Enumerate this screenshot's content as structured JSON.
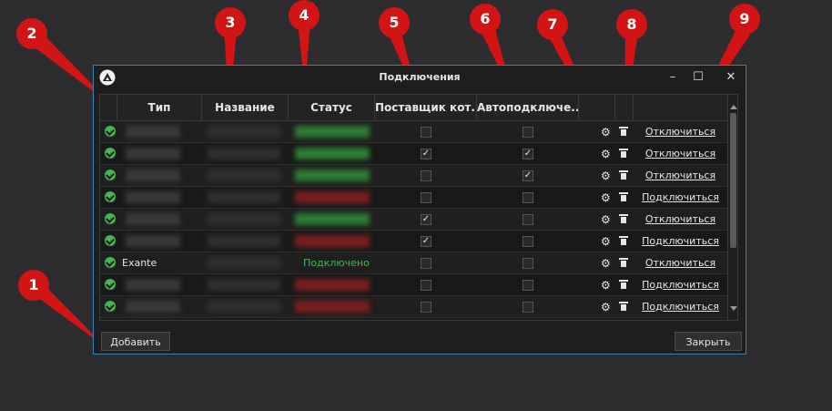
{
  "window": {
    "title": "Подключения",
    "controls": {
      "minimize": "–",
      "maximize": "☐",
      "close": "✕"
    }
  },
  "table": {
    "columns": [
      "Тип",
      "Название",
      "Статус",
      "Поставщик кот...",
      "Автоподключе..."
    ],
    "rows": [
      {
        "type": "",
        "status": "",
        "status_color": "#2e7d32",
        "quotes_provider": false,
        "auto_connect": false,
        "action": "Отключиться"
      },
      {
        "type": "",
        "status": "",
        "status_color": "#2e7d32",
        "quotes_provider": true,
        "auto_connect": true,
        "action": "Отключиться"
      },
      {
        "type": "",
        "status": "",
        "status_color": "#2e7d32",
        "quotes_provider": false,
        "auto_connect": true,
        "action": "Отключиться"
      },
      {
        "type": "",
        "status": "",
        "status_color": "#7a1f1f",
        "quotes_provider": false,
        "auto_connect": false,
        "action": "Подключиться"
      },
      {
        "type": "",
        "status": "",
        "status_color": "#2e7d32",
        "quotes_provider": true,
        "auto_connect": false,
        "action": "Отключиться"
      },
      {
        "type": "",
        "status": "",
        "status_color": "#7a1f1f",
        "quotes_provider": true,
        "auto_connect": false,
        "action": "Подключиться"
      },
      {
        "type": "Exante",
        "status": "Подключено",
        "status_color": "#3fb950",
        "quotes_provider": false,
        "auto_connect": false,
        "action": "Отключиться"
      },
      {
        "type": "",
        "status": "",
        "status_color": "#7a1f1f",
        "quotes_provider": false,
        "auto_connect": false,
        "action": "Подключиться"
      },
      {
        "type": "",
        "status": "",
        "status_color": "#7a1f1f",
        "quotes_provider": false,
        "auto_connect": false,
        "action": "Подключиться"
      }
    ]
  },
  "buttons": {
    "add": "Добавить",
    "close": "Закрыть"
  },
  "callouts": [
    "1",
    "2",
    "3",
    "4",
    "5",
    "6",
    "7",
    "8",
    "9"
  ],
  "colors": {
    "accent": "#3c7fb1",
    "ok": "#3fb950",
    "callout": "#d21414"
  }
}
